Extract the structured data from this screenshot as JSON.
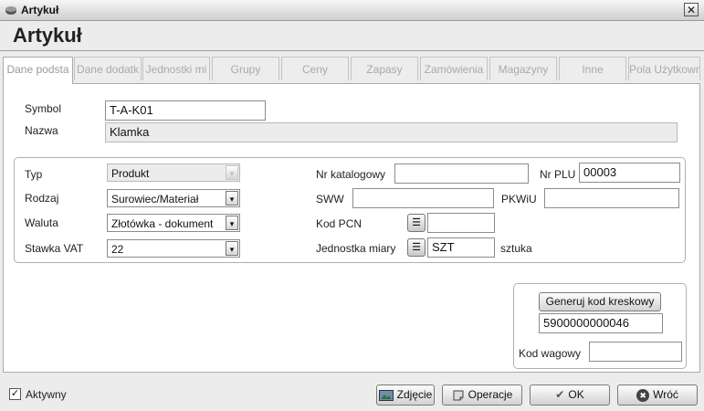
{
  "window": {
    "title": "Artykuł",
    "heading": "Artykuł",
    "close_glyph": "✕"
  },
  "tabs": [
    {
      "label": "Dane podsta",
      "active": true
    },
    {
      "label": "Dane dodatk",
      "active": false
    },
    {
      "label": "Jednostki mi",
      "active": false
    },
    {
      "label": "Grupy",
      "active": false
    },
    {
      "label": "Ceny",
      "active": false
    },
    {
      "label": "Zapasy",
      "active": false
    },
    {
      "label": "Zamówienia",
      "active": false
    },
    {
      "label": "Magazyny",
      "active": false
    },
    {
      "label": "Inne",
      "active": false
    },
    {
      "label": "Pola Użytkown",
      "active": false
    }
  ],
  "form": {
    "symbol_label": "Symbol",
    "symbol_value": "T-A-K01",
    "nazwa_label": "Nazwa",
    "nazwa_value": "Klamka",
    "typ_label": "Typ",
    "typ_value": "Produkt",
    "rodzaj_label": "Rodzaj",
    "rodzaj_value": "Surowiec/Materiał",
    "waluta_label": "Waluta",
    "waluta_value": "Złotówka - dokument",
    "vat_label": "Stawka VAT",
    "vat_value": "22",
    "nr_katalogowy_label": "Nr katalogowy",
    "nr_katalogowy_value": "",
    "nr_plu_label": "Nr PLU",
    "nr_plu_value": "00003",
    "sww_label": "SWW",
    "sww_value": "",
    "pkwiu_label": "PKWiU",
    "pkwiu_value": "",
    "kod_pcn_label": "Kod PCN",
    "kod_pcn_value": "",
    "jm_label": "Jednostka miary",
    "jm_value": "SZT",
    "jm_desc": "sztuka"
  },
  "barcode": {
    "generate_label": "Generuj kod kreskowy",
    "value": "5900000000046",
    "kod_wagowy_label": "Kod wagowy",
    "kod_wagowy_value": ""
  },
  "footer": {
    "aktywny_label": "Aktywny",
    "aktywny_checked": true,
    "check_glyph": "✓",
    "zdjecie_label": "Zdjęcie",
    "operacje_label": "Operacje",
    "ok_label": "OK",
    "wroc_label": "Wróć"
  },
  "icons": {
    "dropdown_glyph": "▾",
    "list_glyph": "☰",
    "ok_glyph": "✔",
    "cancel_glyph": "✖"
  }
}
